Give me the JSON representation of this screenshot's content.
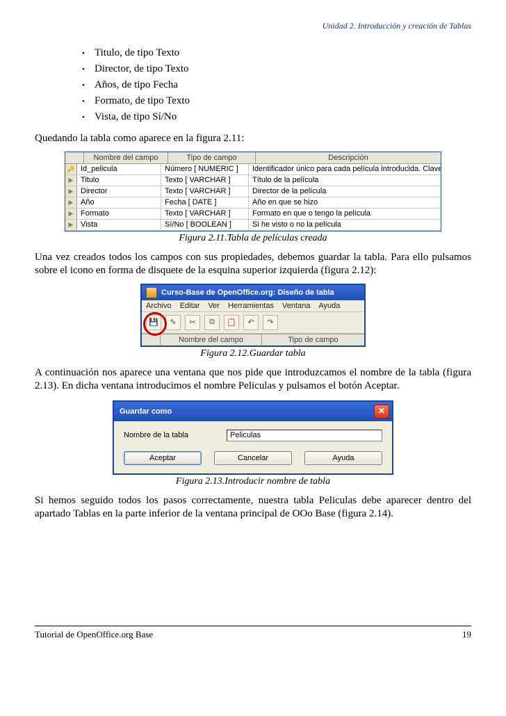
{
  "header": {
    "unit": "Unidad 2. Introducción y creación de Tablas"
  },
  "bullets": [
    "Titulo, de tipo Texto",
    "Director, de tipo Texto",
    "Años, de tipo Fecha",
    "Formato, de tipo Texto",
    "Vista, de tipo Sí/No"
  ],
  "para1": "Quedando la tabla como aparece en la figura 2.11:",
  "fig211": {
    "headers": {
      "name": "Nombre del campo",
      "type": "Tipo de campo",
      "desc": "Descripción"
    },
    "rows": [
      {
        "sel": "🔑",
        "name": "Id_pelicula",
        "type": "Número [ NUMERIC ]",
        "desc": "Identificador único para cada película introducida. Clave primaria"
      },
      {
        "sel": "▶",
        "name": "Titulo",
        "type": "Texto [ VARCHAR ]",
        "desc": "Título de la película"
      },
      {
        "sel": "▶",
        "name": "Director",
        "type": "Texto [ VARCHAR ]",
        "desc": "Director de la película"
      },
      {
        "sel": "▶",
        "name": "Año",
        "type": "Fecha [ DATE ]",
        "desc": "Año en que se hizo"
      },
      {
        "sel": "▶",
        "name": "Formato",
        "type": "Texto [ VARCHAR ]",
        "desc": "Formato en que o tengo la película"
      },
      {
        "sel": "▶",
        "name": "Vista",
        "type": "Sí/No [ BOOLEAN ]",
        "desc": "Si he visto o no la película"
      }
    ],
    "caption": "Figura 2.11.Tabla de películas creada"
  },
  "para2": "Una vez creados todos los campos con sus propiedades, debemos guardar la tabla. Para ello pulsamos sobre el icono en forma de disquete de la esquina superior izquierda (figura 2.12):",
  "fig212": {
    "title": "Curso-Base de OpenOffice.org: Diseño de tabla",
    "menu": [
      "Archivo",
      "Editar",
      "Ver",
      "Herramientas",
      "Ventana",
      "Ayuda"
    ],
    "cols": {
      "name": "Nombre del campo",
      "type": "Tipo de campo"
    },
    "caption": "Figura 2.12.Guardar tabla"
  },
  "para3": "A continuación nos aparece una ventana que nos pide que introduzcamos el nombre de la tabla (figura 2.13). En dicha ventana introducimos el nombre Peliculas y pulsamos el botón Aceptar.",
  "fig213": {
    "title": "Guardar como",
    "label": "Nombre de la tabla",
    "value": "Peliculas",
    "buttons": {
      "ok": "Aceptar",
      "cancel": "Cancelar",
      "help": "Ayuda"
    },
    "caption": "Figura 2.13.Introducir nombre de tabla"
  },
  "para4": "Si hemos seguido todos los pasos correctamente, nuestra tabla Peliculas debe aparecer dentro del apartado Tablas en la parte inferior de la ventana principal de OOo Base (figura 2.14).",
  "footer": {
    "left": "Tutorial de OpenOffice.org Base",
    "right": "19"
  }
}
